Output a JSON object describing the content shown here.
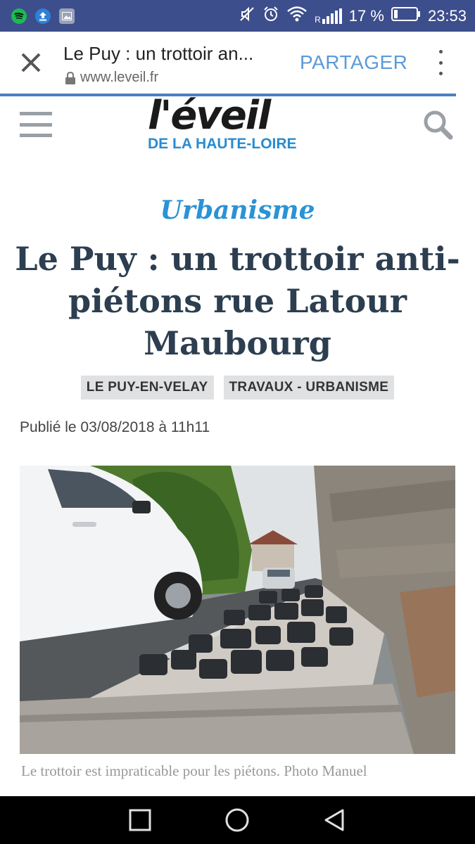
{
  "status_bar": {
    "battery_percent": "17 %",
    "time": "23:53",
    "network_label": "R"
  },
  "toolbar": {
    "title": "Le Puy : un trottoir an...",
    "url": "www.leveil.fr",
    "share_label": "PARTAGER"
  },
  "site": {
    "logo_main": "l'éveil",
    "logo_sub": "DE LA HAUTE-LOIRE"
  },
  "article": {
    "category": "Urbanisme",
    "headline": "Le Puy : un trottoir anti-piétons rue Latour Maubourg",
    "tags": [
      "LE PUY-EN-VELAY",
      "TRAVAUX - URBANISME"
    ],
    "published": "Publié le 03/08/2018 à 11h11",
    "caption": "Le trottoir est impraticable pour les piétons. Photo Manuel"
  },
  "colors": {
    "status_bar": "#3d4e8c",
    "accent_blue": "#2a93d4",
    "headline": "#2c3e50",
    "share": "#5b9ad8"
  },
  "icons": [
    "spotify-icon",
    "upload-icon",
    "gallery-icon",
    "mute-icon",
    "alarm-icon",
    "wifi-icon",
    "signal-icon",
    "battery-icon",
    "close-icon",
    "lock-icon",
    "more-icon",
    "menu-icon",
    "search-icon",
    "recent-apps-icon",
    "home-icon",
    "back-icon"
  ]
}
